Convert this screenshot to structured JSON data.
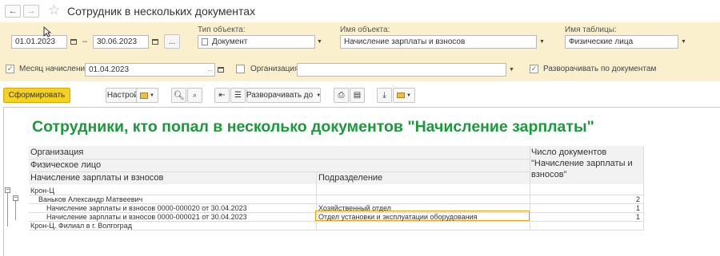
{
  "window": {
    "title": "Сотрудник в нескольких документах"
  },
  "nav": {
    "back": "←",
    "forward": "→",
    "favorite": "☆"
  },
  "filters": {
    "date_from": "01.01.2023",
    "date_separator": "–",
    "date_to": "30.06.2023",
    "period_button": "...",
    "object_type_label": "Тип объекта:",
    "object_type_value": "Документ",
    "object_name_label": "Имя объекта:",
    "object_name_value": "Начисление зарплаты и взносов",
    "table_name_label": "Имя таблицы:",
    "table_name_value": "Физические лица",
    "month_label": "Месяц начисления:",
    "month_value": "01.04.2023",
    "month_checked": true,
    "org_label": "Организация:",
    "org_value": "",
    "org_checked": false,
    "expand_docs_label": "Разворачивать по документам",
    "expand_docs_checked": true
  },
  "toolbar": {
    "generate": "Сформировать",
    "settings": "Настройки...",
    "expand_to": "Разворачивать до"
  },
  "report": {
    "title": "Сотрудники, кто попал в несколько документов \"Начисление зарплаты\"",
    "header": {
      "organization": "Организация",
      "person": "Физическое лицо",
      "document": "Начисление зарплаты и взносов",
      "department": "Подразделение",
      "count_line1": "Число документов",
      "count_line2": "\"Начисление зарплаты и",
      "count_line3": "взносов\""
    },
    "rows": [
      {
        "level": 0,
        "text": "Крон-Ц",
        "department": "",
        "count": ""
      },
      {
        "level": 1,
        "text": "Ваньков Александр Матвеевич",
        "department": "",
        "count": "2"
      },
      {
        "level": 2,
        "text": "Начисление зарплаты и взносов 0000-000020 от 30.04.2023",
        "department": "Хозяйственный отдел",
        "count": "1"
      },
      {
        "level": 2,
        "text": "Начисление зарплаты и взносов 0000-000021 от 30.04.2023",
        "department": "Отдел установки и эксплуатации оборудования",
        "count": "1"
      },
      {
        "level": 0,
        "text": "Крон-Ц. Филиал в г. Волгоград",
        "department": "",
        "count": ""
      }
    ]
  },
  "colors": {
    "panel": "#fbf0ce",
    "primary_button": "#f4d21f",
    "title_green": "#1a9a3a",
    "selection": "#e8a317"
  }
}
